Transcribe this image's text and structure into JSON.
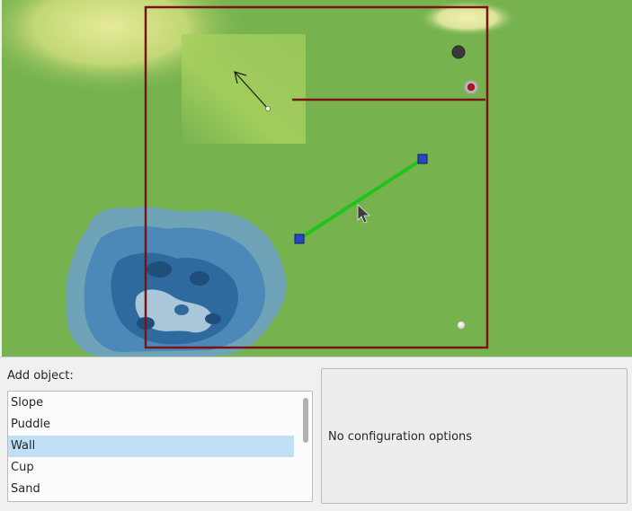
{
  "course": {
    "objects": [
      "course-boundary",
      "divider-wall",
      "selected-wall",
      "putt-direction-arrow",
      "hole",
      "ball",
      "black-hole",
      "puddle",
      "sand-patch",
      "slope"
    ],
    "colors": {
      "grass": "#76b34f",
      "boundary": "#7a1414",
      "selected_wall": "#22c31d",
      "handle": "#2a46c8",
      "puddle": "#4a90c8"
    }
  },
  "add_object": {
    "label": "Add object:",
    "items": [
      "Slope",
      "Puddle",
      "Wall",
      "Cup",
      "Sand"
    ],
    "selected": "Wall"
  },
  "config_panel": {
    "message": "No configuration options"
  }
}
